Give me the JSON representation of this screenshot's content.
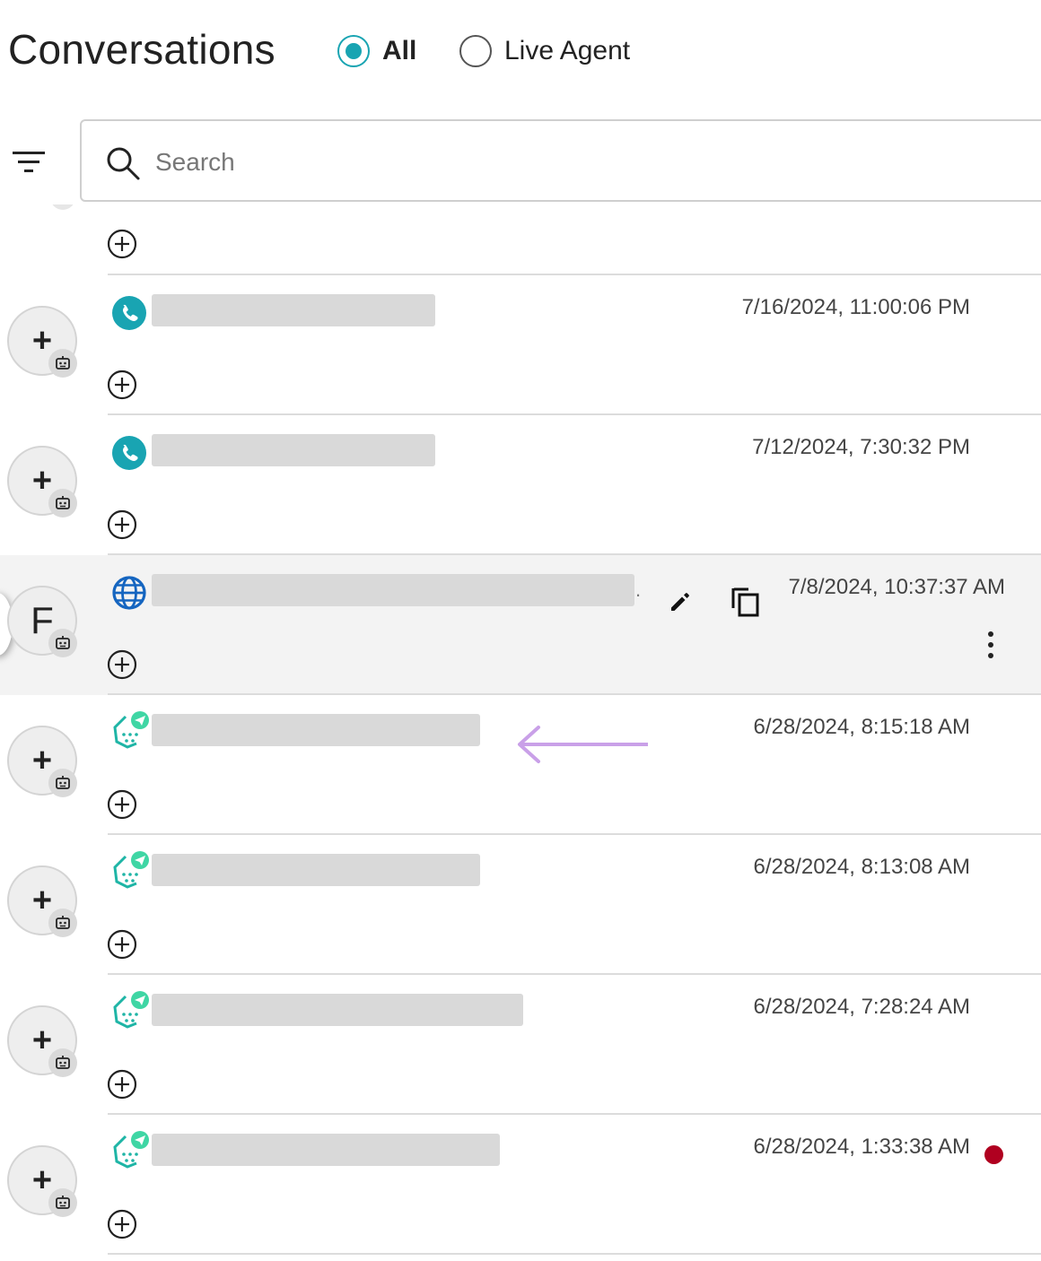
{
  "header": {
    "title": "Conversations",
    "filter_options": [
      {
        "label": "All",
        "checked": true
      },
      {
        "label": "Live Agent",
        "checked": false
      }
    ]
  },
  "search": {
    "placeholder": "Search",
    "value": ""
  },
  "colors": {
    "accent": "#19a4b2",
    "unread": "#b00020",
    "redacted": "#d9d9d9",
    "selected_row": "#f3f3f3",
    "arrow_annotation": "#c9a0e8"
  },
  "conversations": [
    {
      "avatar": "+",
      "channel": "phone-icon",
      "timestamp": "7/16/2024, 11:00:06 PM"
    },
    {
      "avatar": "+",
      "channel": "phone-icon",
      "timestamp": "7/12/2024, 7:30:32 PM"
    },
    {
      "avatar": "F",
      "channel": "web-icon",
      "timestamp": "7/8/2024, 10:37:37 AM",
      "selected": true
    },
    {
      "avatar": "+",
      "channel": "telegram-bot-icon",
      "timestamp": "6/28/2024, 8:15:18 AM"
    },
    {
      "avatar": "+",
      "channel": "telegram-bot-icon",
      "timestamp": "6/28/2024, 8:13:08 AM"
    },
    {
      "avatar": "+",
      "channel": "telegram-bot-icon",
      "timestamp": "6/28/2024, 7:28:24 AM"
    },
    {
      "avatar": "+",
      "channel": "telegram-bot-icon",
      "timestamp": "6/28/2024, 1:33:38 AM",
      "unread": true
    }
  ]
}
